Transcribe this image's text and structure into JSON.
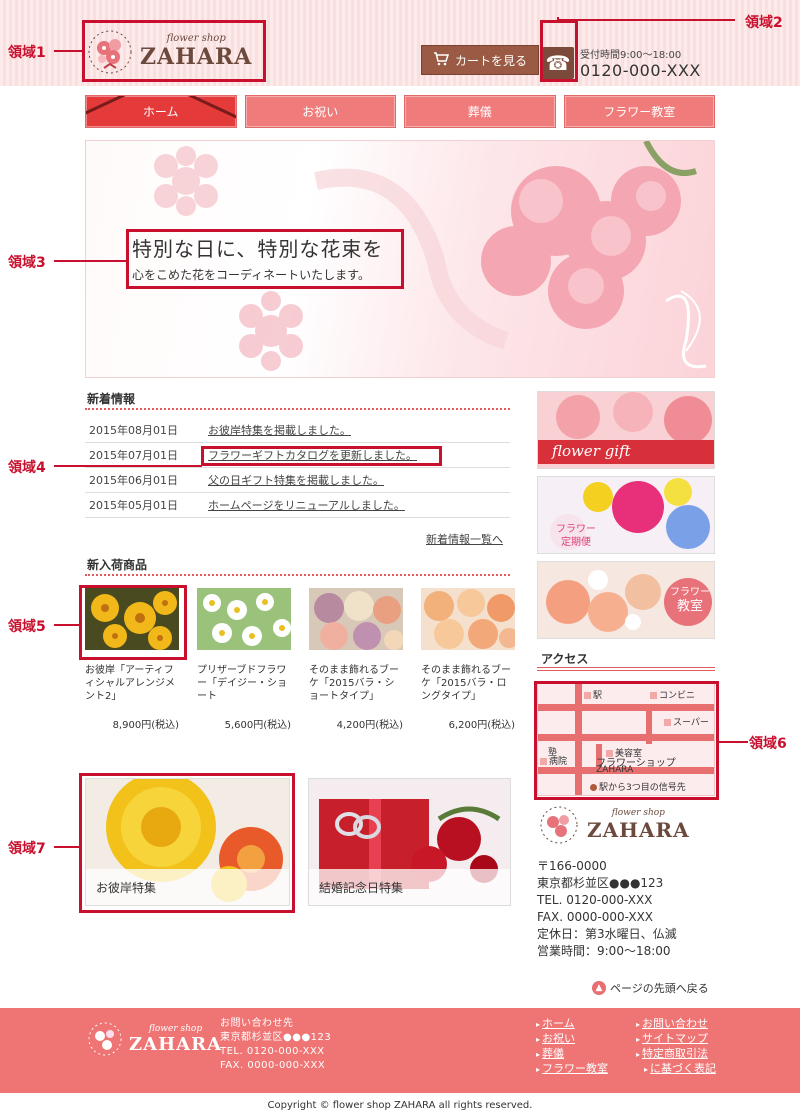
{
  "header": {
    "logo_small": "flower shop",
    "logo_big": "ZAHARA",
    "cart_label": "カートを見る",
    "hours": "受付時間9:00～18:00",
    "phone": "0120-000-XXX"
  },
  "nav": [
    "ホーム",
    "お祝い",
    "葬儀",
    "フラワー教室"
  ],
  "hero": {
    "title": "特別な日に、特別な花束を",
    "subtitle": "心をこめた花をコーディネートいたします。"
  },
  "news": {
    "title": "新着情報",
    "items": [
      {
        "date": "2015年08月01日",
        "text": "お彼岸特集を掲載しました。"
      },
      {
        "date": "2015年07月01日",
        "text": "フラワーギフトカタログを更新しました。"
      },
      {
        "date": "2015年06月01日",
        "text": "父の日ギフト特集を掲載しました。"
      },
      {
        "date": "2015年05月01日",
        "text": "ホームページをリニューアルしました。"
      }
    ],
    "more": "新着情報一覧へ"
  },
  "products": {
    "title": "新入荷商品",
    "items": [
      {
        "name": "お彼岸「アーティフィシャルアレンジメント2」",
        "price": "8,900円(税込)"
      },
      {
        "name": "プリザーブドフラワー「デイジー・ショート",
        "price": "5,600円(税込)"
      },
      {
        "name": "そのまま飾れるブーケ「2015バラ・ショートタイプ」",
        "price": "4,200円(税込)"
      },
      {
        "name": "そのまま飾れるブーケ「2015バラ・ロングタイプ」",
        "price": "6,200円(税込)"
      }
    ]
  },
  "features": [
    "お彼岸特集",
    "結婚記念日特集"
  ],
  "sidebar": {
    "banner1": "flower gift",
    "banner2_a": "フラワー",
    "banner2_b": "定期便",
    "banner3_a": "フラワー",
    "banner3_b": "教室",
    "access_title": "アクセス",
    "map": {
      "station": "駅",
      "conbini": "コンビニ",
      "super": "スーパー",
      "juku": "塾",
      "salon": "美容室",
      "hospital": "病院",
      "shop1": "フラワーショップ",
      "shop2": "ZAHARA",
      "directions": "駅から3つ目の信号先"
    },
    "address": [
      "〒166-0000",
      "東京都杉並区●●●123",
      "TEL. 0120-000-XXX",
      "FAX. 0000-000-XXX",
      "定休日：第3水曜日、仏滅",
      "営業時間：9:00～18:00"
    ]
  },
  "pagetop": "ページの先頭へ戻る",
  "footer": {
    "contact": [
      "お問い合わせ先",
      "東京都杉並区●●●123",
      "TEL. 0120-000-XXX",
      "FAX. 0000-000-XXX"
    ],
    "col1": [
      "ホーム",
      "お祝い",
      "葬儀",
      "フラワー教室"
    ],
    "col2": [
      "お問い合わせ",
      "サイトマップ",
      "特定商取引法",
      "に基づく表記"
    ],
    "copyright": "Copyright © flower shop ZAHARA all rights reserved."
  },
  "annotations": [
    "領域1",
    "領域2",
    "領域3",
    "領域4",
    "領域5",
    "領域6",
    "領域7"
  ],
  "colors": {
    "accent": "#ef7474",
    "annotation": "#c8102e",
    "brown": "#9a5a43"
  }
}
